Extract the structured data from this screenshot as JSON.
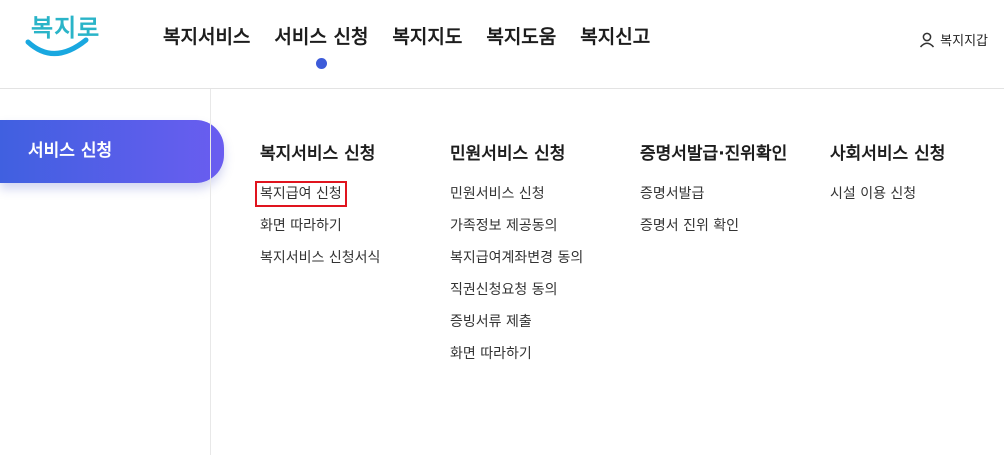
{
  "logo": {
    "text": "복지로"
  },
  "gnb": [
    {
      "label": "복지서비스"
    },
    {
      "label": "서비스 신청"
    },
    {
      "label": "복지지도"
    },
    {
      "label": "복지도움"
    },
    {
      "label": "복지신고"
    }
  ],
  "gnb_active_index": 1,
  "user": {
    "label": "복지지갑",
    "icon": "user-icon"
  },
  "side": {
    "label": "서비스 신청"
  },
  "columns": [
    {
      "title": "복지서비스 신청",
      "items": [
        "복지급여 신청",
        "화면 따라하기",
        "복지서비스 신청서식"
      ]
    },
    {
      "title": "민원서비스 신청",
      "items": [
        "민원서비스 신청",
        "가족정보 제공동의",
        "복지급여계좌변경 동의",
        "직권신청요청 동의",
        "증빙서류 제출",
        "화면 따라하기"
      ]
    },
    {
      "title": "증명서발급·진위확인",
      "items": [
        "증명서발급",
        "증명서 진위 확인"
      ]
    },
    {
      "title": "사회서비스 신청",
      "items": [
        "시설 이용 신청"
      ]
    }
  ],
  "colors": {
    "accent": "#3d5bd9",
    "pill_start": "#4060e0",
    "pill_end": "#6a5df0",
    "highlight": "#e0141e",
    "logo": "#2ab4c8"
  }
}
